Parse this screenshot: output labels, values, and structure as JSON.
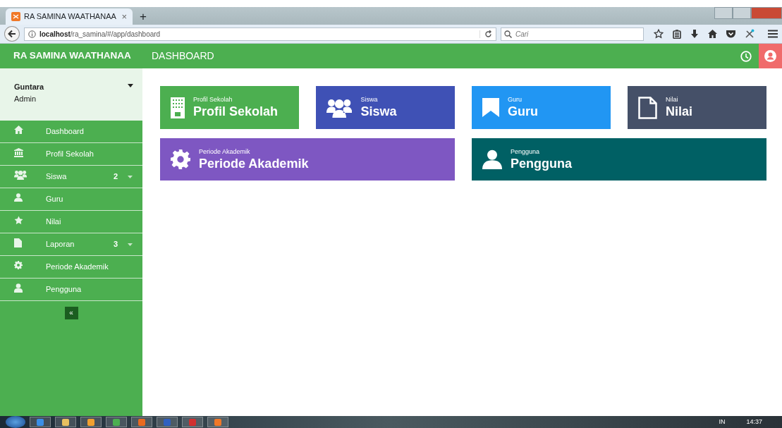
{
  "browser": {
    "tab": {
      "title": "RA SAMINA WAATHANAA",
      "close": "×"
    },
    "new_tab": "+",
    "url": "**localhost**/ra_samina/#/app/dashboard",
    "search": {
      "placeholder": "Cari"
    }
  },
  "app_header": {
    "brand": "RA SAMINA WAATHANAA",
    "page_title": "DASHBOARD"
  },
  "sidebar": {
    "user": {
      "name": "Guntara",
      "role": "Admin"
    },
    "items": [
      {
        "kind": "home",
        "label": "Dashboard"
      },
      {
        "kind": "bank",
        "label": "Profil Sekolah"
      },
      {
        "kind": "users",
        "label": "Siswa",
        "badge": "2",
        "expandable": true
      },
      {
        "kind": "user",
        "label": "Guru"
      },
      {
        "kind": "star",
        "label": "Nilai"
      },
      {
        "kind": "file",
        "label": "Laporan",
        "badge": "3",
        "expandable": true
      },
      {
        "kind": "gear",
        "label": "Periode Akademik"
      },
      {
        "kind": "person",
        "label": "Pengguna"
      }
    ],
    "collapse": "«"
  },
  "tiles": [
    {
      "label": "Profil Sekolah",
      "title": "Profil Sekolah",
      "kind": "building",
      "color": "#4caf50",
      "wide": false
    },
    {
      "label": "Siswa",
      "title": "Siswa",
      "kind": "users",
      "color": "#3f51b5",
      "wide": false
    },
    {
      "label": "Guru",
      "title": "Guru",
      "kind": "bookmark",
      "color": "#2196f3",
      "wide": false
    },
    {
      "label": "Nilai",
      "title": "Nilai",
      "kind": "file-outline",
      "color": "#455068",
      "wide": false
    },
    {
      "label": "Periode Akademik",
      "title": "Periode Akademik",
      "kind": "gear",
      "color": "#7e57c2",
      "wide": true
    },
    {
      "label": "Pengguna",
      "title": "Pengguna",
      "kind": "user",
      "color": "#006064",
      "wide": true
    }
  ],
  "taskbar": {
    "language": "IN",
    "time": "14:37"
  }
}
